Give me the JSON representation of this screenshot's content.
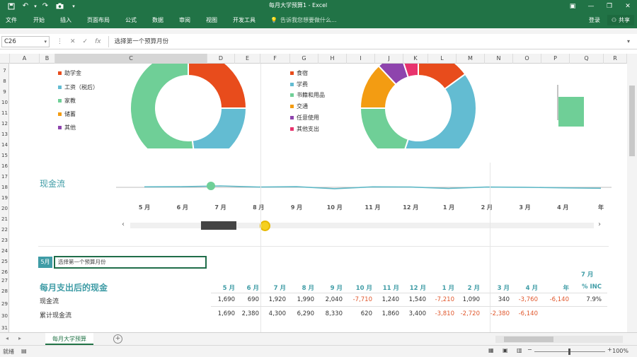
{
  "window": {
    "title": "每月大学预算1 - Excel",
    "colors": {
      "ribbon": "#217346",
      "teal": "#3f9ca6",
      "accent_green": "#1f8f6a"
    }
  },
  "ribbon": {
    "tabs": [
      "文件",
      "开始",
      "插入",
      "页面布局",
      "公式",
      "数据",
      "审阅",
      "视图",
      "开发工具"
    ],
    "tell_me": "告诉我您想要做什么...",
    "sign_in": "登录",
    "share": "共享"
  },
  "formula_bar": {
    "name_box": "C26",
    "formula": "选择第一个预算月份"
  },
  "columns": [
    "A",
    "B",
    "C",
    "D",
    "E",
    "F",
    "G",
    "H",
    "I",
    "J",
    "K",
    "L",
    "M",
    "N",
    "O",
    "P",
    "Q",
    "R"
  ],
  "rows": [
    "7",
    "8",
    "9",
    "10",
    "11",
    "12",
    "13",
    "14",
    "15",
    "16",
    "17",
    "18",
    "19",
    "20",
    "21",
    "22",
    "23",
    "24",
    "25",
    "26",
    "27",
    "28",
    "29",
    "30",
    "31"
  ],
  "income_legend": [
    {
      "label": "助学金",
      "color": "#e84c1c"
    },
    {
      "label": "工资（税后）",
      "color": "#63bcd2"
    },
    {
      "label": "家教",
      "color": "#6fcf97"
    },
    {
      "label": "储蓄",
      "color": "#f39c12"
    },
    {
      "label": "其他",
      "color": "#8e44ad"
    }
  ],
  "expense_legend": [
    {
      "label": "食宿",
      "color": "#e84c1c"
    },
    {
      "label": "学费",
      "color": "#63bcd2"
    },
    {
      "label": "书籍和用品",
      "color": "#6fcf97"
    },
    {
      "label": "交通",
      "color": "#f39c12"
    },
    {
      "label": "任意使用",
      "color": "#8e44ad"
    },
    {
      "label": "其他支出",
      "color": "#e8336d"
    }
  ],
  "chart_data": [
    {
      "type": "pie",
      "categories": [
        "助学金",
        "工资（税后）",
        "家教",
        "储蓄",
        "其他"
      ],
      "values": [
        25,
        23,
        52,
        0,
        0
      ],
      "title": ""
    },
    {
      "type": "pie",
      "categories": [
        "食宿",
        "学费",
        "书籍和用品",
        "交通",
        "任意使用",
        "其他支出"
      ],
      "values": [
        15,
        40,
        20,
        13,
        7,
        5
      ],
      "title": ""
    },
    {
      "type": "line",
      "title": "现金流",
      "categories": [
        "5 月",
        "6 月",
        "7 月",
        "8 月",
        "9 月",
        "10 月",
        "11 月",
        "12 月",
        "1 月",
        "2 月",
        "3 月",
        "4 月",
        "年"
      ],
      "series": [
        {
          "values": [
            0.6,
            0.5,
            0.0,
            0.7,
            0.5,
            1.8,
            0.6,
            0.7,
            1.6,
            0.7,
            0.9,
            1.2,
            1.5
          ]
        }
      ],
      "selected_index": 2
    }
  ],
  "month_axis": [
    "5 月",
    "6 月",
    "7 月",
    "8 月",
    "9 月",
    "10 月",
    "11 月",
    "12 月",
    "1 月",
    "2 月",
    "3 月",
    "4 月",
    "年"
  ],
  "selector": {
    "month_label": "5月",
    "input_text": "选择第一个预算月份"
  },
  "table": {
    "title": "每月支出后的现金",
    "pct_header_top": "7 月",
    "headers": [
      "5 月",
      "6 月",
      "7 月",
      "8 月",
      "9 月",
      "10 月",
      "11 月",
      "12 月",
      "1 月",
      "2 月",
      "3 月",
      "4 月",
      "年",
      "% INC"
    ],
    "rows": [
      {
        "label": "现金流",
        "values": [
          "1,690",
          "690",
          "1,920",
          "1,990",
          "2,040",
          "-7,710",
          "1,240",
          "1,540",
          "-7,210",
          "1,090",
          "340",
          "-3,760",
          "-6,140",
          "7.9%"
        ]
      },
      {
        "label": "累计现金流",
        "values": [
          "1,690",
          "2,380",
          "4,300",
          "6,290",
          "8,330",
          "620",
          "1,860",
          "3,400",
          "-3,810",
          "-2,720",
          "-2,380",
          "-6,140",
          "",
          ""
        ]
      }
    ]
  },
  "sheet_tab": "每月大学预算",
  "status": {
    "left": "就绪",
    "zoom": "100%"
  }
}
